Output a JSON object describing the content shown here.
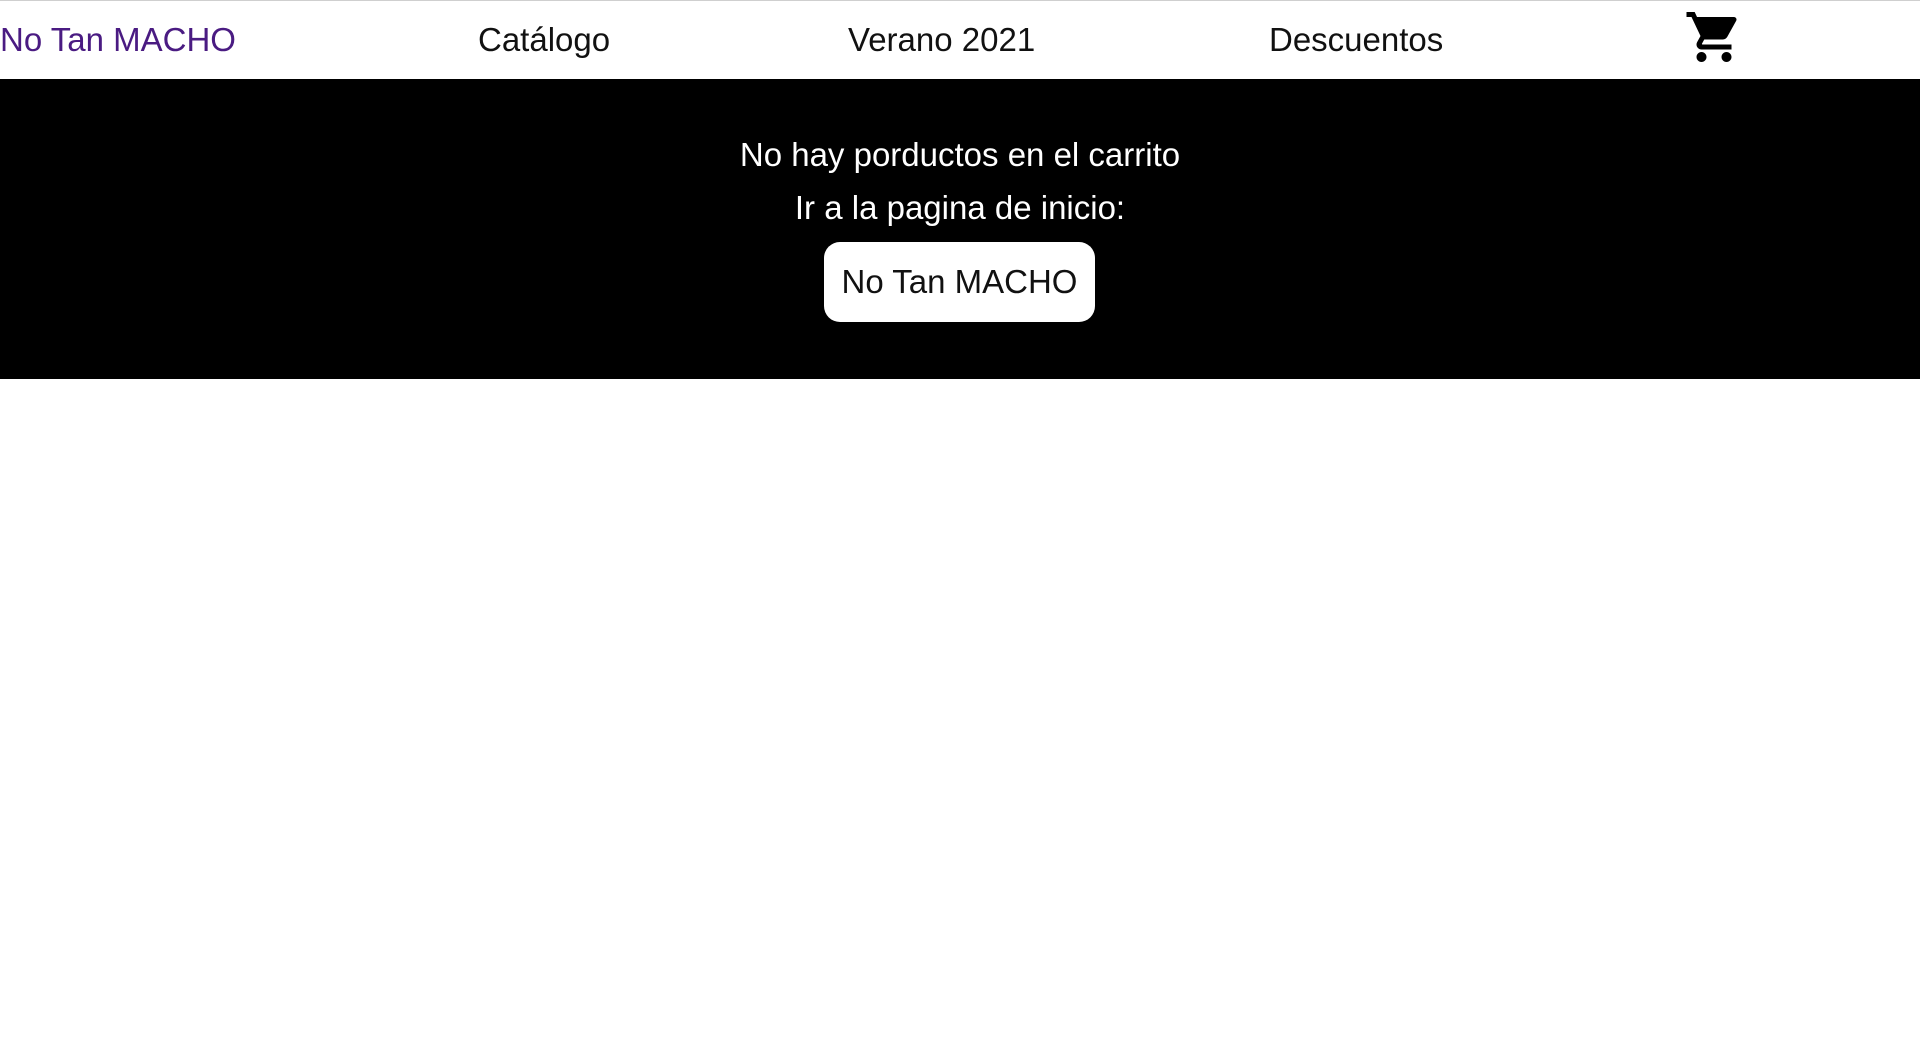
{
  "nav": {
    "brand": "No Tan MACHO",
    "links": [
      "Catálogo",
      "Verano 2021",
      "Descuentos"
    ],
    "cart_icon": "shopping-cart-icon"
  },
  "cart_page": {
    "empty_message": "No hay porductos en el carrito",
    "home_hint": "Ir a la pagina de inicio:",
    "home_button_label": "No Tan MACHO"
  },
  "colors": {
    "brand": "#4a1b82",
    "panel_background": "#000000",
    "button_background": "#ffffff"
  }
}
